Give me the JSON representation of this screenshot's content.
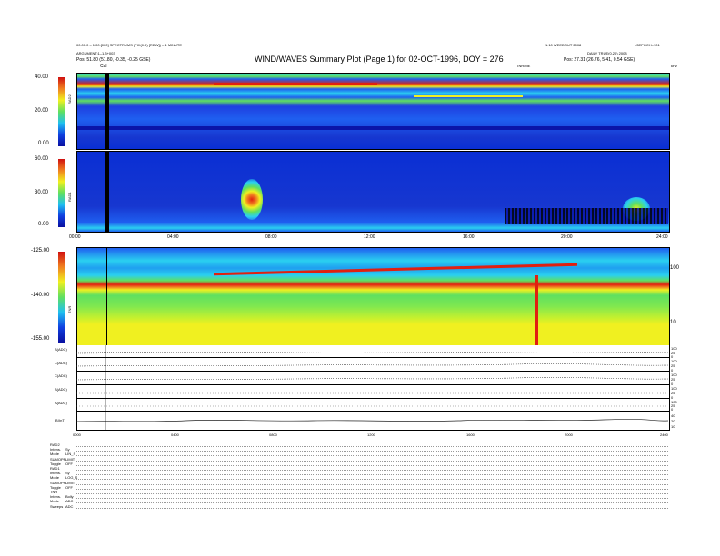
{
  "header": {
    "title": "WIND/WAVES Summary Plot (Page 1) for 02-OCT-1996, DOY = 276",
    "left_line1": "00:00.0 – 1:00.[000] SPECTRUMS (FIX(0.9) [RDW]) – 1 MINUTE",
    "left_line2": "ARGUMENT:1–1.3+003",
    "left_line3": "Pos:    51.80 (51.80, -0.35, -0.25 GSE)",
    "right_line1": "1.10 WEEDOUT 2008",
    "right_line2": "DAILY  TRUE(0.20) 2008",
    "right_line3": "Pos:    27.31 (26.76, 5.41, 0.54 GSE)",
    "right_corner": "L3EPOCH=101",
    "cal_label": "Cal",
    "tnr_label": "TNR/ME",
    "khz": "kHz"
  },
  "colors": {
    "deep_blue": "#0a2fd4",
    "blue": "#1f5ff0",
    "cyan": "#2ad0f0",
    "green": "#5fe060",
    "yellow": "#f0f020",
    "orange": "#f08020",
    "red": "#e02010"
  },
  "chart_data": [
    {
      "type": "heatmap",
      "name": "RAD2",
      "ylabel": "RAD2",
      "colorbar_ticks": [
        "40.00",
        "20.00",
        "0.00"
      ],
      "colorbar_range": [
        0,
        40
      ]
    },
    {
      "type": "heatmap",
      "name": "RAD1",
      "ylabel": "RAD1",
      "colorbar_ticks": [
        "60.00",
        "30.00",
        "0.00"
      ],
      "colorbar_range": [
        0,
        60
      ],
      "x_ticks": [
        "00:00",
        "04:00",
        "08:00",
        "12:00",
        "16:00",
        "20:00",
        "24:00"
      ]
    },
    {
      "type": "heatmap",
      "name": "TNR",
      "ylabel": "TNR",
      "colorbar_ticks": [
        "-125.00",
        "-140.00",
        "-155.00"
      ],
      "colorbar_range": [
        -155,
        -125
      ],
      "right_ticks": [
        "100",
        "10"
      ],
      "right_label": "kHz"
    },
    {
      "type": "line",
      "name": "time-series strips",
      "strips": [
        {
          "label": "B(ADC)",
          "right_ticks": [
            "100",
            "25",
            "0"
          ]
        },
        {
          "label": "C(ADC)",
          "right_ticks": [
            "100",
            "25",
            "0"
          ]
        },
        {
          "label": "C(ADC)",
          "right_ticks": [
            "100",
            "25",
            "0"
          ]
        },
        {
          "label": "B(ADC)",
          "right_ticks": [
            "100",
            "25",
            "0"
          ]
        },
        {
          "label": "A(ADC)",
          "right_ticks": [
            "100",
            "25",
            "0"
          ]
        },
        {
          "label": "|B|(nT)",
          "right_ticks": [
            "40",
            "20",
            "10"
          ]
        }
      ],
      "x_ticks": [
        "0000",
        "0400",
        "0800",
        "1200",
        "1600",
        "2000",
        "2400"
      ]
    }
  ],
  "footer": {
    "rows": [
      {
        "k": "RAD2",
        "v": ""
      },
      {
        "k": "Intens.",
        "v": "Sy"
      },
      {
        "k": "Mode",
        "v": "LIN_S"
      },
      {
        "k": "SUMOPR.",
        "v": "LIMIT"
      },
      {
        "k": "Toggle",
        "v": "OFF"
      },
      {
        "k": "RAD1",
        "v": ""
      },
      {
        "k": "Intens.",
        "v": "Sy"
      },
      {
        "k": "Mode",
        "v": "LOG_S"
      },
      {
        "k": "SUMOPR.",
        "v": "LIMIT"
      },
      {
        "k": "Toggle",
        "v": "OFF"
      },
      {
        "k": "TNR",
        "v": ""
      },
      {
        "k": "Intens.",
        "v": "Bolly"
      },
      {
        "k": "Mode",
        "v": "ADC"
      },
      {
        "k": "Sweeps",
        "v": "ADC"
      }
    ]
  }
}
